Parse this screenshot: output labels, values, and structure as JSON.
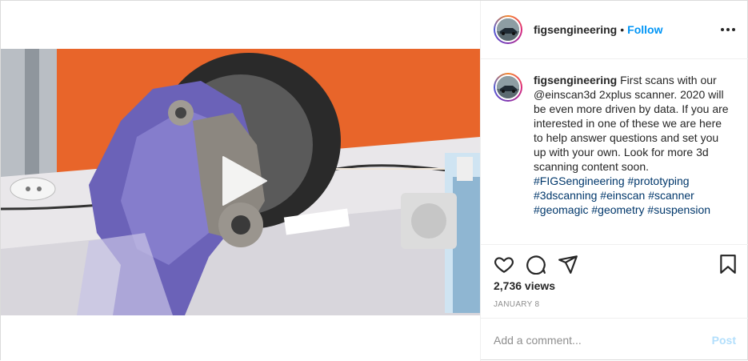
{
  "post": {
    "username": "figsengineering",
    "separator": "•",
    "follow_label": "Follow",
    "more_icon": "more-horizontal-icon",
    "caption": {
      "username": "figsengineering",
      "text": "First scans with our @einscan3d 2xplus scanner. 2020 will be even more driven by data. If you are interested in one of these we are here to help answer questions and set you up with your own. Look for more 3d scanning content soon.",
      "hashtags": "#FIGSengineering #prototyping #3dscanning #einscan #scanner #geomagic #geometry #suspension"
    },
    "actions": {
      "like_icon": "heart-icon",
      "comment_icon": "comment-icon",
      "share_icon": "share-icon",
      "save_icon": "bookmark-icon"
    },
    "views": "2,736 views",
    "date": "JANUARY 8",
    "comment_placeholder": "Add a comment...",
    "post_label": "Post",
    "video": {
      "play_icon": "play-icon"
    }
  },
  "colors": {
    "follow": "#0095f6",
    "post_disabled": "#b2dffc",
    "hashtag": "#00376b",
    "muted": "#8e8e8e",
    "video_wall": "#e8652a"
  }
}
